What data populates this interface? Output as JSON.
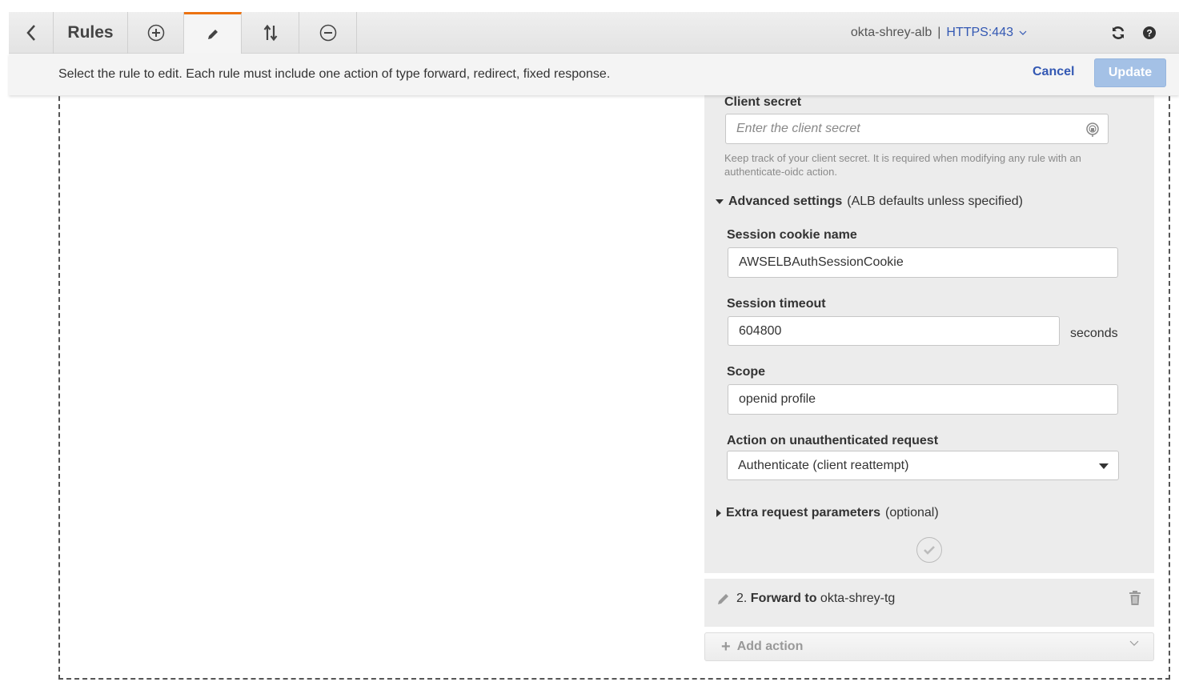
{
  "toolbar": {
    "title": "Rules",
    "load_balancer": "okta-shrey-alb",
    "separator": "|",
    "listener": "HTTPS:443",
    "icons": {
      "back": "chevron-left-icon",
      "add": "plus-circle-icon",
      "edit": "pencil-icon",
      "reorder": "sort-arrows-icon",
      "remove": "minus-circle-icon",
      "refresh": "refresh-icon",
      "help": "help-icon"
    },
    "active_tab": "edit",
    "accent_color": "#ec7211"
  },
  "infobar": {
    "message": "Select the rule to edit. Each rule must include one action of type forward, redirect, fixed response.",
    "cancel_label": "Cancel",
    "update_label": "Update"
  },
  "panel": {
    "client_secret": {
      "label": "Client secret",
      "placeholder": "Enter the client secret",
      "value": "",
      "hint": "Keep track of your client secret. It is required when modifying any rule with an authenticate-oidc action."
    },
    "advanced": {
      "title": "Advanced settings",
      "subtitle": "(ALB defaults unless specified)",
      "expanded": true,
      "session_cookie": {
        "label": "Session cookie name",
        "value": "AWSELBAuthSessionCookie"
      },
      "session_timeout": {
        "label": "Session timeout",
        "value": "604800",
        "unit": "seconds"
      },
      "scope": {
        "label": "Scope",
        "value": "openid profile"
      },
      "unauth_action": {
        "label": "Action on unauthenticated request",
        "value": "Authenticate (client reattempt)"
      }
    },
    "extra_params": {
      "title": "Extra request parameters",
      "subtitle": "(optional)",
      "expanded": false
    }
  },
  "forward_action": {
    "number": "2.",
    "verb": "Forward to",
    "target": "okta-shrey-tg"
  },
  "add_action": {
    "label": "Add action"
  }
}
